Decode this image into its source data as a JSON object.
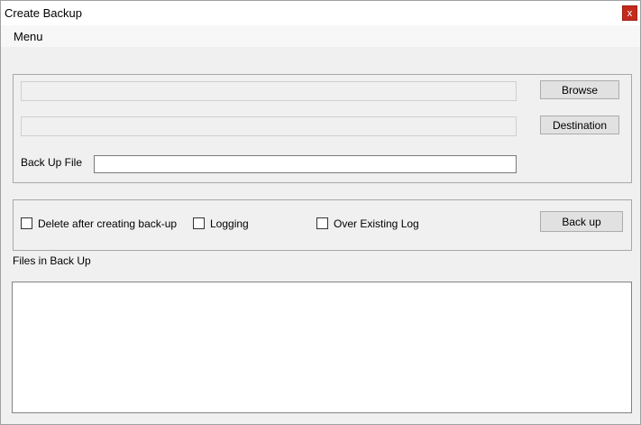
{
  "window": {
    "title": "Create Backup",
    "close_label": "x",
    "close_color": "#c42b1c"
  },
  "menu": {
    "items": [
      "Menu"
    ]
  },
  "paths": {
    "source_value": "",
    "destination_value": "",
    "browse_label": "Browse",
    "destination_label": "Destination",
    "backup_file_label": "Back Up File",
    "backup_file_value": ""
  },
  "options": {
    "delete_after_label": "Delete after creating back-up",
    "delete_after_checked": false,
    "logging_label": "Logging",
    "logging_checked": false,
    "overwrite_log_label": "Over Existing Log",
    "overwrite_log_checked": false,
    "backup_button_label": "Back up"
  },
  "files": {
    "label": "Files in Back Up",
    "items": []
  }
}
